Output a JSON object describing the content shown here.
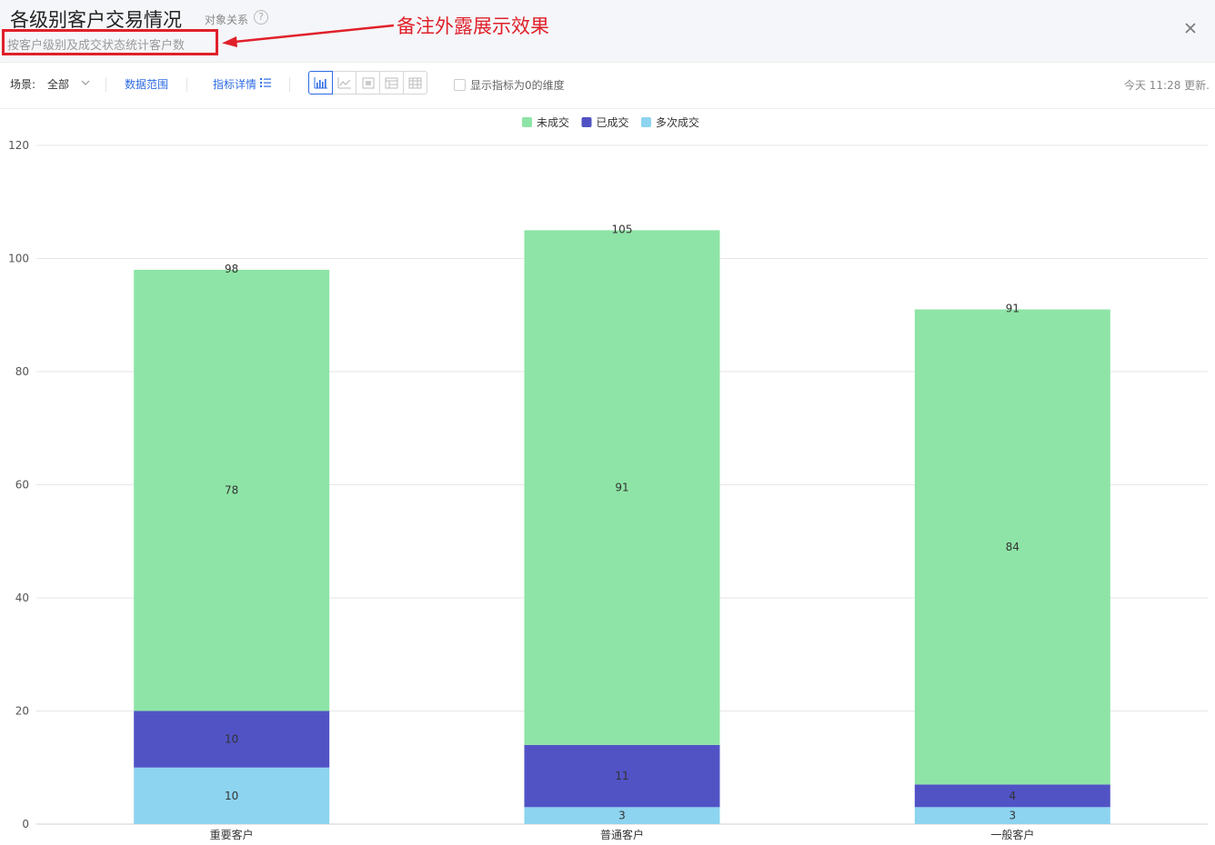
{
  "header": {
    "title": "各级别客户交易情况",
    "object_relation": "对象关系",
    "help_glyph": "?",
    "subtitle": "按客户级别及成交状态统计客户数",
    "annotation": "备注外露展示效果",
    "close_icon": "close-icon"
  },
  "toolbar": {
    "scene_label": "场景:",
    "scene_value": "全部",
    "data_range": "数据范围",
    "metric_detail": "指标详情",
    "view_icons": [
      "bar-chart-icon",
      "line-chart-icon",
      "pivot-icon",
      "table-icon",
      "grid-table-icon"
    ],
    "show_zero_label": "显示指标为0的维度",
    "updated": "今天 11:28 更新."
  },
  "colors": {
    "not_closed": "#8ee4a6",
    "closed": "#5153c5",
    "multi_closed": "#8dd4f0",
    "accent": "#2d6be4",
    "annotation_red": "#e0202a"
  },
  "chart_data": {
    "type": "bar",
    "stacked": true,
    "categories": [
      "重要客户",
      "普通客户",
      "一般客户"
    ],
    "series": [
      {
        "name": "多次成交",
        "values": [
          10,
          3,
          3
        ],
        "color": "#8dd4f0"
      },
      {
        "name": "已成交",
        "values": [
          10,
          11,
          4
        ],
        "color": "#5153c5"
      },
      {
        "name": "未成交",
        "values": [
          78,
          91,
          84
        ],
        "color": "#8ee4a6"
      }
    ],
    "totals": [
      98,
      105,
      91
    ],
    "legend_order": [
      "未成交",
      "已成交",
      "多次成交"
    ],
    "legend_position": "top-center",
    "yticks": [
      0,
      20,
      40,
      60,
      80,
      100,
      120
    ],
    "ylim": [
      0,
      120
    ],
    "grid": true
  }
}
